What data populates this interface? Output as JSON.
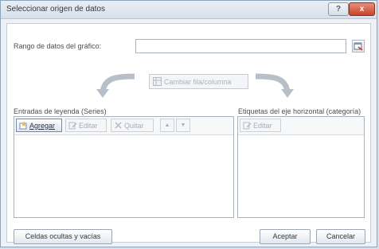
{
  "window": {
    "title": "Seleccionar origen de datos",
    "help_label": "?",
    "close_label": "x"
  },
  "range": {
    "label": "Rango de datos del gráfico:",
    "value": ""
  },
  "switch_button": {
    "label": "Cambiar fila/columna"
  },
  "series": {
    "heading": "Entradas de leyenda (Series)",
    "toolbar": {
      "add_label": "Agregar",
      "edit_label": "Editar",
      "remove_label": "Quitar",
      "up_label": "▲",
      "down_label": "▼"
    },
    "items": []
  },
  "categories": {
    "heading": "Etiquetas del eje horizontal (categoría)",
    "toolbar": {
      "edit_label": "Editar"
    },
    "items": []
  },
  "footer": {
    "hidden_cells_label": "Celdas ocultas y vacías",
    "ok_label": "Aceptar",
    "cancel_label": "Cancelar"
  },
  "colors": {
    "close_button": "#c8432d",
    "accent_border": "#6f8cb0"
  }
}
